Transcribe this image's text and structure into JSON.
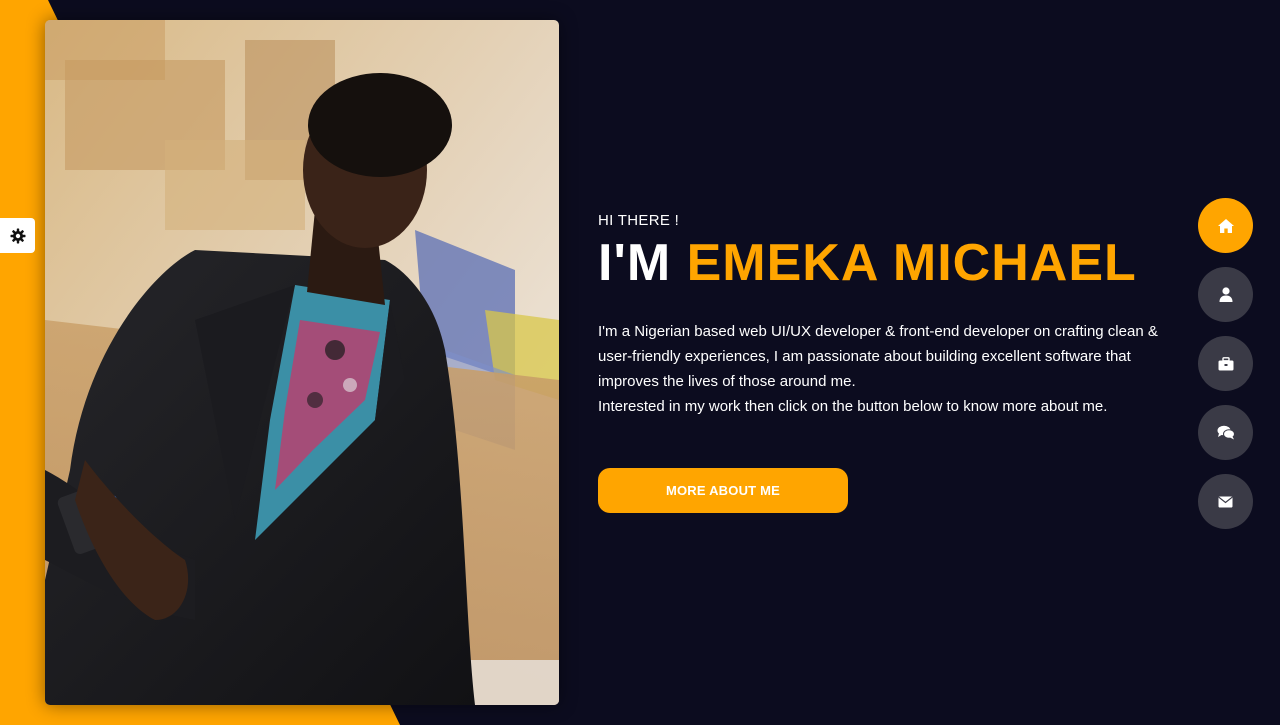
{
  "colors": {
    "accent": "#ffa500",
    "background": "#0c0c1f",
    "nav_inactive": "#3a3a46"
  },
  "settings": {
    "icon": "gear-icon"
  },
  "hero": {
    "greeting": "HI THERE !",
    "prefix": "I'M",
    "name": "EMEKA MICHAEL",
    "bio_line1": "I'm a Nigerian based web UI/UX developer & front-end developer on crafting clean & user-friendly experiences, I am passionate about building excellent software that improves the lives of those around me.",
    "bio_line2": "Interested in my work then click on the button below to know more about me.",
    "cta_label": "MORE ABOUT ME"
  },
  "nav": {
    "items": [
      {
        "icon": "home-icon",
        "active": true
      },
      {
        "icon": "user-icon",
        "active": false
      },
      {
        "icon": "briefcase-icon",
        "active": false
      },
      {
        "icon": "comments-icon",
        "active": false
      },
      {
        "icon": "envelope-icon",
        "active": false
      }
    ]
  }
}
